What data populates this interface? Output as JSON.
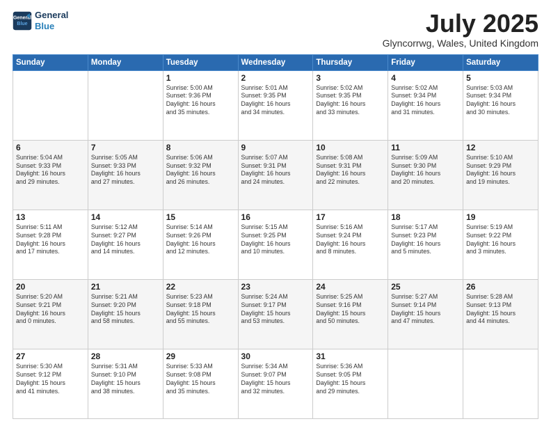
{
  "header": {
    "logo_line1": "General",
    "logo_line2": "Blue",
    "month": "July 2025",
    "location": "Glyncorrwg, Wales, United Kingdom"
  },
  "weekdays": [
    "Sunday",
    "Monday",
    "Tuesday",
    "Wednesday",
    "Thursday",
    "Friday",
    "Saturday"
  ],
  "weeks": [
    [
      {
        "day": "",
        "info": ""
      },
      {
        "day": "",
        "info": ""
      },
      {
        "day": "1",
        "info": "Sunrise: 5:00 AM\nSunset: 9:36 PM\nDaylight: 16 hours\nand 35 minutes."
      },
      {
        "day": "2",
        "info": "Sunrise: 5:01 AM\nSunset: 9:35 PM\nDaylight: 16 hours\nand 34 minutes."
      },
      {
        "day": "3",
        "info": "Sunrise: 5:02 AM\nSunset: 9:35 PM\nDaylight: 16 hours\nand 33 minutes."
      },
      {
        "day": "4",
        "info": "Sunrise: 5:02 AM\nSunset: 9:34 PM\nDaylight: 16 hours\nand 31 minutes."
      },
      {
        "day": "5",
        "info": "Sunrise: 5:03 AM\nSunset: 9:34 PM\nDaylight: 16 hours\nand 30 minutes."
      }
    ],
    [
      {
        "day": "6",
        "info": "Sunrise: 5:04 AM\nSunset: 9:33 PM\nDaylight: 16 hours\nand 29 minutes."
      },
      {
        "day": "7",
        "info": "Sunrise: 5:05 AM\nSunset: 9:33 PM\nDaylight: 16 hours\nand 27 minutes."
      },
      {
        "day": "8",
        "info": "Sunrise: 5:06 AM\nSunset: 9:32 PM\nDaylight: 16 hours\nand 26 minutes."
      },
      {
        "day": "9",
        "info": "Sunrise: 5:07 AM\nSunset: 9:31 PM\nDaylight: 16 hours\nand 24 minutes."
      },
      {
        "day": "10",
        "info": "Sunrise: 5:08 AM\nSunset: 9:31 PM\nDaylight: 16 hours\nand 22 minutes."
      },
      {
        "day": "11",
        "info": "Sunrise: 5:09 AM\nSunset: 9:30 PM\nDaylight: 16 hours\nand 20 minutes."
      },
      {
        "day": "12",
        "info": "Sunrise: 5:10 AM\nSunset: 9:29 PM\nDaylight: 16 hours\nand 19 minutes."
      }
    ],
    [
      {
        "day": "13",
        "info": "Sunrise: 5:11 AM\nSunset: 9:28 PM\nDaylight: 16 hours\nand 17 minutes."
      },
      {
        "day": "14",
        "info": "Sunrise: 5:12 AM\nSunset: 9:27 PM\nDaylight: 16 hours\nand 14 minutes."
      },
      {
        "day": "15",
        "info": "Sunrise: 5:14 AM\nSunset: 9:26 PM\nDaylight: 16 hours\nand 12 minutes."
      },
      {
        "day": "16",
        "info": "Sunrise: 5:15 AM\nSunset: 9:25 PM\nDaylight: 16 hours\nand 10 minutes."
      },
      {
        "day": "17",
        "info": "Sunrise: 5:16 AM\nSunset: 9:24 PM\nDaylight: 16 hours\nand 8 minutes."
      },
      {
        "day": "18",
        "info": "Sunrise: 5:17 AM\nSunset: 9:23 PM\nDaylight: 16 hours\nand 5 minutes."
      },
      {
        "day": "19",
        "info": "Sunrise: 5:19 AM\nSunset: 9:22 PM\nDaylight: 16 hours\nand 3 minutes."
      }
    ],
    [
      {
        "day": "20",
        "info": "Sunrise: 5:20 AM\nSunset: 9:21 PM\nDaylight: 16 hours\nand 0 minutes."
      },
      {
        "day": "21",
        "info": "Sunrise: 5:21 AM\nSunset: 9:20 PM\nDaylight: 15 hours\nand 58 minutes."
      },
      {
        "day": "22",
        "info": "Sunrise: 5:23 AM\nSunset: 9:18 PM\nDaylight: 15 hours\nand 55 minutes."
      },
      {
        "day": "23",
        "info": "Sunrise: 5:24 AM\nSunset: 9:17 PM\nDaylight: 15 hours\nand 53 minutes."
      },
      {
        "day": "24",
        "info": "Sunrise: 5:25 AM\nSunset: 9:16 PM\nDaylight: 15 hours\nand 50 minutes."
      },
      {
        "day": "25",
        "info": "Sunrise: 5:27 AM\nSunset: 9:14 PM\nDaylight: 15 hours\nand 47 minutes."
      },
      {
        "day": "26",
        "info": "Sunrise: 5:28 AM\nSunset: 9:13 PM\nDaylight: 15 hours\nand 44 minutes."
      }
    ],
    [
      {
        "day": "27",
        "info": "Sunrise: 5:30 AM\nSunset: 9:12 PM\nDaylight: 15 hours\nand 41 minutes."
      },
      {
        "day": "28",
        "info": "Sunrise: 5:31 AM\nSunset: 9:10 PM\nDaylight: 15 hours\nand 38 minutes."
      },
      {
        "day": "29",
        "info": "Sunrise: 5:33 AM\nSunset: 9:08 PM\nDaylight: 15 hours\nand 35 minutes."
      },
      {
        "day": "30",
        "info": "Sunrise: 5:34 AM\nSunset: 9:07 PM\nDaylight: 15 hours\nand 32 minutes."
      },
      {
        "day": "31",
        "info": "Sunrise: 5:36 AM\nSunset: 9:05 PM\nDaylight: 15 hours\nand 29 minutes."
      },
      {
        "day": "",
        "info": ""
      },
      {
        "day": "",
        "info": ""
      }
    ]
  ]
}
